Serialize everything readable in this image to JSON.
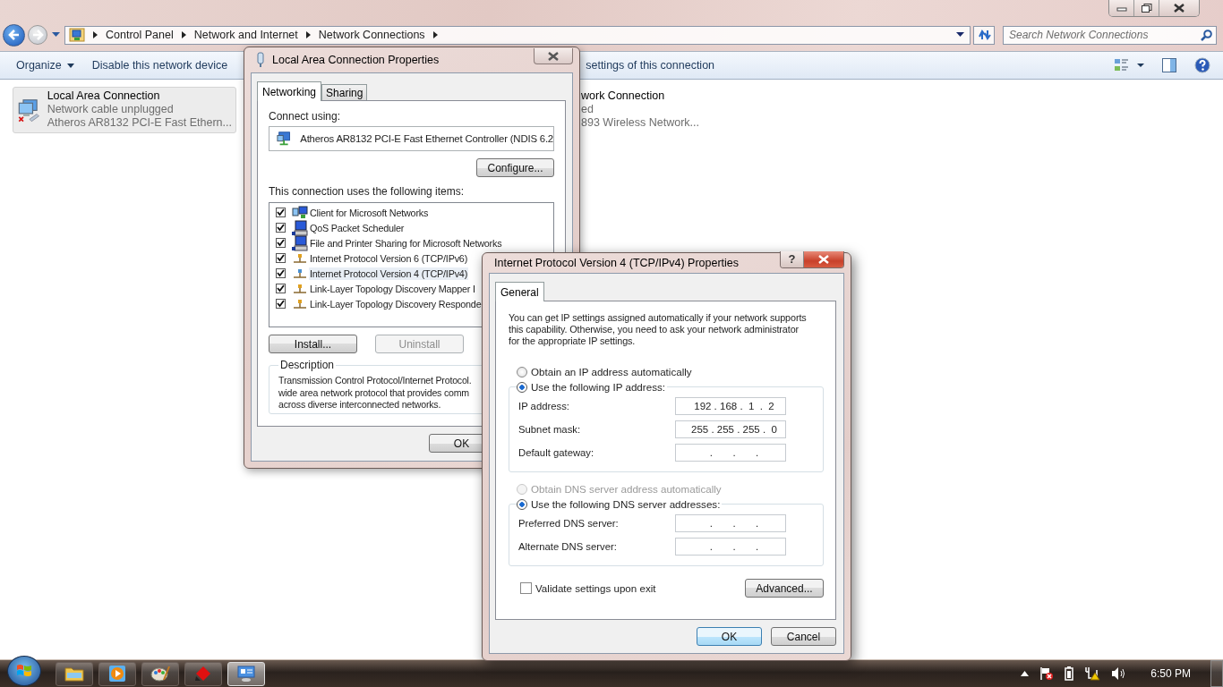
{
  "explorer": {
    "breadcrumb": [
      "Control Panel",
      "Network and Internet",
      "Network Connections"
    ],
    "search": {
      "placeholder": "Search Network Connections"
    },
    "toolbar": [
      {
        "label": "Organize",
        "kind": "menu"
      },
      {
        "label": "Disable this network device",
        "kind": "action"
      },
      {
        "label": "settings of this connection",
        "kind": "partial"
      }
    ],
    "connections": [
      {
        "name": "Local Area Connection",
        "status": "Network cable unplugged",
        "device": "Atheros AR8132 PCI-E Fast Ethern...",
        "selected": true,
        "kind": "wired"
      },
      {
        "name": "work Connection",
        "status": "ed",
        "device": "893 Wireless Network...",
        "selected": false,
        "kind": "partial"
      }
    ]
  },
  "lan_dialog": {
    "title": "Local Area Connection Properties",
    "tabs": [
      {
        "label": "Networking",
        "selected": true
      },
      {
        "label": "Sharing",
        "selected": false
      }
    ],
    "connect_label": "Connect using:",
    "adapter": "Atheros AR8132 PCI-E Fast Ethernet Controller (NDIS 6.2",
    "configure": "Configure...",
    "items_label": "This connection uses the following items:",
    "items": [
      {
        "label": "Client for Microsoft Networks",
        "checked": true,
        "selected": false,
        "kind": "client"
      },
      {
        "label": "QoS Packet Scheduler",
        "checked": true,
        "selected": false,
        "kind": "service"
      },
      {
        "label": "File and Printer Sharing for Microsoft Networks",
        "checked": true,
        "selected": false,
        "kind": "service"
      },
      {
        "label": "Internet Protocol Version 6 (TCP/IPv6)",
        "checked": true,
        "selected": false,
        "kind": "protocol"
      },
      {
        "label": "Internet Protocol Version 4 (TCP/IPv4)",
        "checked": true,
        "selected": true,
        "kind": "protocol"
      },
      {
        "label": "Link-Layer Topology Discovery Mapper I",
        "checked": true,
        "selected": false,
        "kind": "protocol"
      },
      {
        "label": "Link-Layer Topology Discovery Responde",
        "checked": true,
        "selected": false,
        "kind": "protocol"
      }
    ],
    "buttons": [
      {
        "label": "Install...",
        "disabled": false
      },
      {
        "label": "Uninstall",
        "disabled": true
      }
    ],
    "description_title": "Description",
    "description": "Transmission Control Protocol/Internet Protocol.\nwide area network protocol that provides comm\nacross diverse interconnected networks.",
    "ok": "OK"
  },
  "ipv4_dialog": {
    "title": "Internet Protocol Version 4 (TCP/IPv4) Properties",
    "help": "?",
    "tabs": [
      {
        "label": "General",
        "selected": true
      }
    ],
    "intro": "You can get IP settings assigned automatically if your network supports\nthis capability. Otherwise, you need to ask your network administrator\nfor the appropriate IP settings.",
    "ip_auto": {
      "label": "Obtain an IP address automatically",
      "selected": false,
      "disabled": false
    },
    "ip_manual": {
      "label": "Use the following IP address:",
      "selected": true,
      "disabled": false
    },
    "ip_fields": [
      {
        "label": "IP address:",
        "value": "192 . 168 .  1  .  2"
      },
      {
        "label": "Subnet mask:",
        "value": "255 . 255 . 255 .  0"
      },
      {
        "label": "Default gateway:",
        "value": ".       .       ."
      }
    ],
    "dns_auto": {
      "label": "Obtain DNS server address automatically",
      "selected": false,
      "disabled": true
    },
    "dns_manual": {
      "label": "Use the following DNS server addresses:",
      "selected": true,
      "disabled": false
    },
    "dns_fields": [
      {
        "label": "Preferred DNS server:",
        "value": ".       .       ."
      },
      {
        "label": "Alternate DNS server:",
        "value": ".       .       ."
      }
    ],
    "validate": {
      "label": "Validate settings upon exit",
      "checked": false
    },
    "advanced": "Advanced...",
    "buttons": [
      {
        "label": "OK",
        "default": true
      },
      {
        "label": "Cancel",
        "default": false
      }
    ]
  },
  "taskbar": {
    "apps": [
      {
        "kind": "folder",
        "active": false
      },
      {
        "kind": "media",
        "active": false
      },
      {
        "kind": "paint",
        "active": false
      },
      {
        "kind": "red",
        "active": false
      },
      {
        "kind": "network",
        "active": true
      }
    ],
    "clock": "6:50 PM"
  }
}
